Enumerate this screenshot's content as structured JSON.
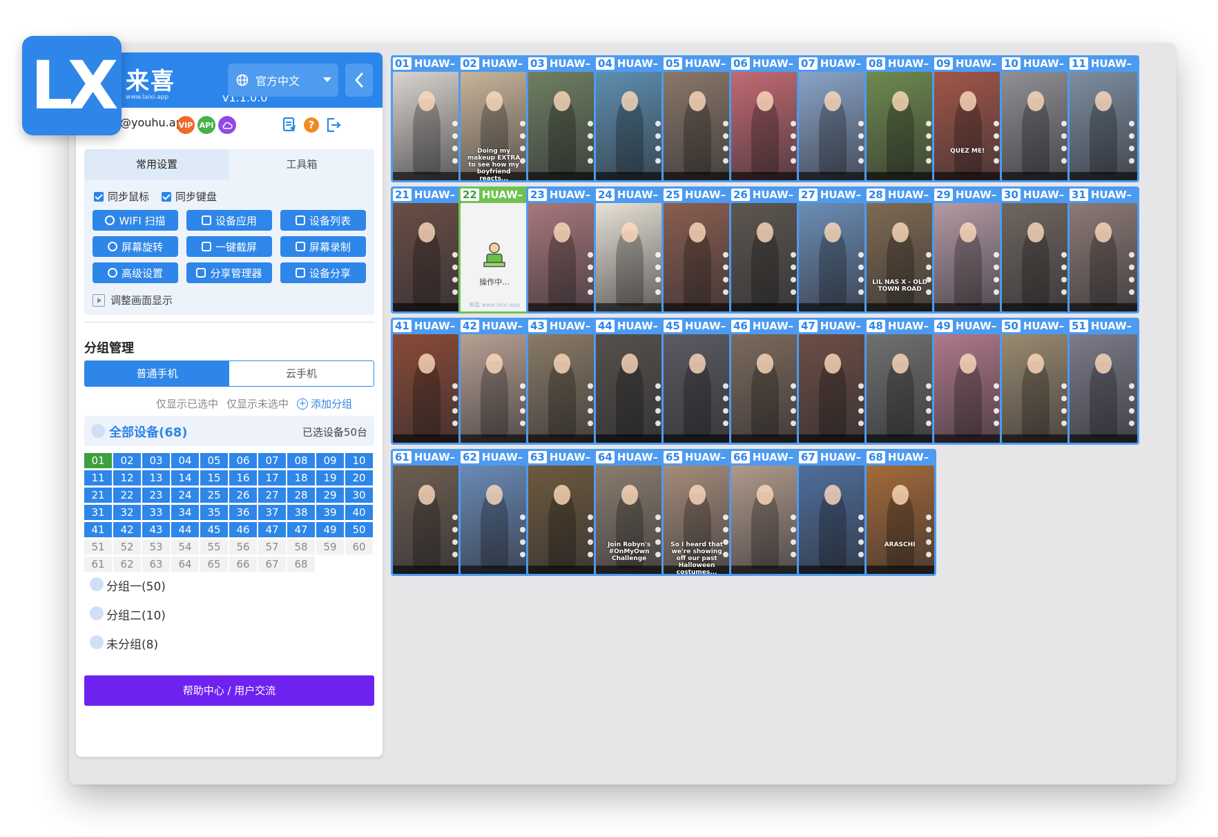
{
  "logo": {
    "text": "LX"
  },
  "header": {
    "brand_name": "来喜",
    "brand_url": "www.laixi.app",
    "version": "v1.1.0.0",
    "language": "官方中文"
  },
  "user": {
    "name": "@youhu.app",
    "badges": [
      "VIP",
      "API"
    ]
  },
  "settings": {
    "tabs": [
      "常用设置",
      "工具箱"
    ],
    "sync_mouse": "同步鼠标",
    "sync_keyboard": "同步键盘",
    "buttons": [
      "WIFI 扫描",
      "设备应用",
      "设备列表",
      "屏幕旋转",
      "一键截屏",
      "屏幕录制",
      "高级设置",
      "分享管理器",
      "设备分享"
    ],
    "adjust": "调整画面显示"
  },
  "groups": {
    "title": "分组管理",
    "segments": [
      "普通手机",
      "云手机"
    ],
    "filter_selected": "仅显示已选中",
    "filter_unselected": "仅显示未选中",
    "add_group": "添加分组",
    "all_devices": "全部设备(68)",
    "selected_count": "已选设备50台",
    "device_numbers": [
      "01",
      "02",
      "03",
      "04",
      "05",
      "06",
      "07",
      "08",
      "09",
      "10",
      "11",
      "12",
      "13",
      "14",
      "15",
      "16",
      "17",
      "18",
      "19",
      "20",
      "21",
      "22",
      "23",
      "24",
      "25",
      "26",
      "27",
      "28",
      "29",
      "30",
      "31",
      "32",
      "33",
      "34",
      "35",
      "36",
      "37",
      "38",
      "39",
      "40",
      "41",
      "42",
      "43",
      "44",
      "45",
      "46",
      "47",
      "47",
      "49",
      "50",
      "51",
      "52",
      "53",
      "54",
      "55",
      "56",
      "57",
      "58",
      "59",
      "60",
      "61",
      "62",
      "63",
      "64",
      "65",
      "66",
      "67",
      "68"
    ],
    "group_list": [
      "分组一(50)",
      "分组二(10)",
      "未分组(8)"
    ],
    "help_button": "帮助中心 / 用户交流"
  },
  "phones": [
    {
      "num": "01",
      "label": "HUAW–",
      "color": "#d9d4cf"
    },
    {
      "num": "02",
      "label": "HUAW–",
      "color": "#c9b59b",
      "caption": "Doing my makeup EXTRA to see how my boyfriend reacts..."
    },
    {
      "num": "03",
      "label": "HUAW–",
      "color": "#6f7f62"
    },
    {
      "num": "04",
      "label": "HUAW–",
      "color": "#5d8fb0"
    },
    {
      "num": "05",
      "label": "HUAW–",
      "color": "#8a7769"
    },
    {
      "num": "06",
      "label": "HUAW–",
      "color": "#c26a72"
    },
    {
      "num": "07",
      "label": "HUAW–",
      "color": "#8aa4c8"
    },
    {
      "num": "08",
      "label": "HUAW–",
      "color": "#6e8a4e"
    },
    {
      "num": "09",
      "label": "HUAW–",
      "color": "#a2564a",
      "caption": "QUEZ ME!"
    },
    {
      "num": "10",
      "label": "HUAW–",
      "color": "#8f8f94"
    },
    {
      "num": "11",
      "label": "HUAW–",
      "color": "#7d8ea0"
    },
    {
      "num": "21",
      "label": "HUAW–",
      "color": "#6a4e46"
    },
    {
      "num": "22",
      "label": "HUAW–",
      "status": "操作中...",
      "footer": "来喜 www.laixi.app"
    },
    {
      "num": "23",
      "label": "HUAW–",
      "color": "#a7787c"
    },
    {
      "num": "24",
      "label": "HUAW–",
      "color": "#e8e2d6"
    },
    {
      "num": "25",
      "label": "HUAW–",
      "color": "#8a5e50"
    },
    {
      "num": "26",
      "label": "HUAW–",
      "color": "#5d5650"
    },
    {
      "num": "27",
      "label": "HUAW–",
      "color": "#6c8db6"
    },
    {
      "num": "28",
      "label": "HUAW–",
      "color": "#7f6a52",
      "caption": "LIL NAS X - OLD TOWN ROAD"
    },
    {
      "num": "29",
      "label": "HUAW–",
      "color": "#b49aa5"
    },
    {
      "num": "30",
      "label": "HUAW–",
      "color": "#6e6660"
    },
    {
      "num": "31",
      "label": "HUAW–",
      "color": "#8c7a75"
    },
    {
      "num": "41",
      "label": "HUAW–",
      "color": "#8a4a38"
    },
    {
      "num": "42",
      "label": "HUAW–",
      "color": "#b7a093"
    },
    {
      "num": "43",
      "label": "HUAW–",
      "color": "#8a7a66"
    },
    {
      "num": "44",
      "label": "HUAW–",
      "color": "#55504c"
    },
    {
      "num": "45",
      "label": "HUAW–",
      "color": "#5c5a62"
    },
    {
      "num": "46",
      "label": "HUAW–",
      "color": "#7b6a5c"
    },
    {
      "num": "47",
      "label": "HUAW–",
      "color": "#6c4e44"
    },
    {
      "num": "48",
      "label": "HUAW–",
      "color": "#707070"
    },
    {
      "num": "49",
      "label": "HUAW–",
      "color": "#b0788a"
    },
    {
      "num": "50",
      "label": "HUAW–",
      "color": "#9a8a70"
    },
    {
      "num": "51",
      "label": "HUAW–",
      "color": "#7b7b8a"
    },
    {
      "num": "61",
      "label": "HUAW–",
      "color": "#6d5e52"
    },
    {
      "num": "62",
      "label": "HUAW–",
      "color": "#6a8ab6"
    },
    {
      "num": "63",
      "label": "HUAW–",
      "color": "#6e5a3e"
    },
    {
      "num": "64",
      "label": "HUAW–",
      "color": "#8a7d70",
      "caption": "Join Robyn's #OnMyOwn Challenge"
    },
    {
      "num": "65",
      "label": "HUAW–",
      "color": "#a58c7a",
      "caption": "So I heard that we're showing off our past Halloween costumes..."
    },
    {
      "num": "66",
      "label": "HUAW–",
      "color": "#b09a8c"
    },
    {
      "num": "67",
      "label": "HUAW–",
      "color": "#4f6e9c"
    },
    {
      "num": "68",
      "label": "HUAW–",
      "color": "#a46a3a",
      "caption": "ARASCHI"
    }
  ]
}
